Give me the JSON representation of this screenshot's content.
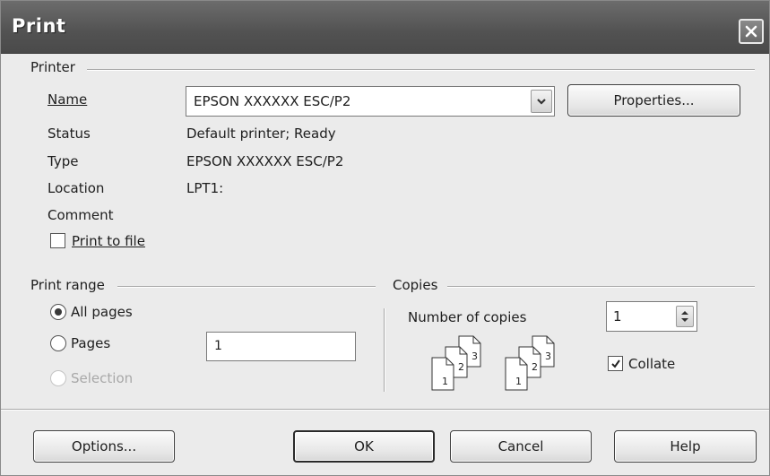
{
  "window": {
    "title": "Print",
    "close_symbol": "×"
  },
  "printer": {
    "group_label": "Printer",
    "name_label": "Name",
    "name_value": "EPSON XXXXXX ESC/P2",
    "properties_label": "Properties...",
    "status_label": "Status",
    "status_value": "Default printer; Ready",
    "type_label": "Type",
    "type_value": "EPSON XXXXXX ESC/P2",
    "location_label": "Location",
    "location_value": "LPT1:",
    "comment_label": "Comment",
    "comment_value": "",
    "print_to_file_label": "Print to file",
    "print_to_file_checked": false
  },
  "print_range": {
    "group_label": "Print range",
    "all_pages_label": "All pages",
    "pages_label": "Pages",
    "pages_value": "1",
    "selection_label": "Selection",
    "selected": "All pages"
  },
  "copies": {
    "group_label": "Copies",
    "number_label": "Number of copies",
    "number_value": "1",
    "collate_label": "Collate",
    "collate_checked": true,
    "icon_sheet_numbers": [
      "1",
      "2",
      "3"
    ]
  },
  "buttons": {
    "options": "Options...",
    "ok": "OK",
    "cancel": "Cancel",
    "help": "Help"
  },
  "icons": {
    "close": "close-icon",
    "dropdown": "chevron-down-icon",
    "spinner": "spin-arrows-icon",
    "collate": "collate-pages-icon",
    "check": "checkmark-icon"
  }
}
